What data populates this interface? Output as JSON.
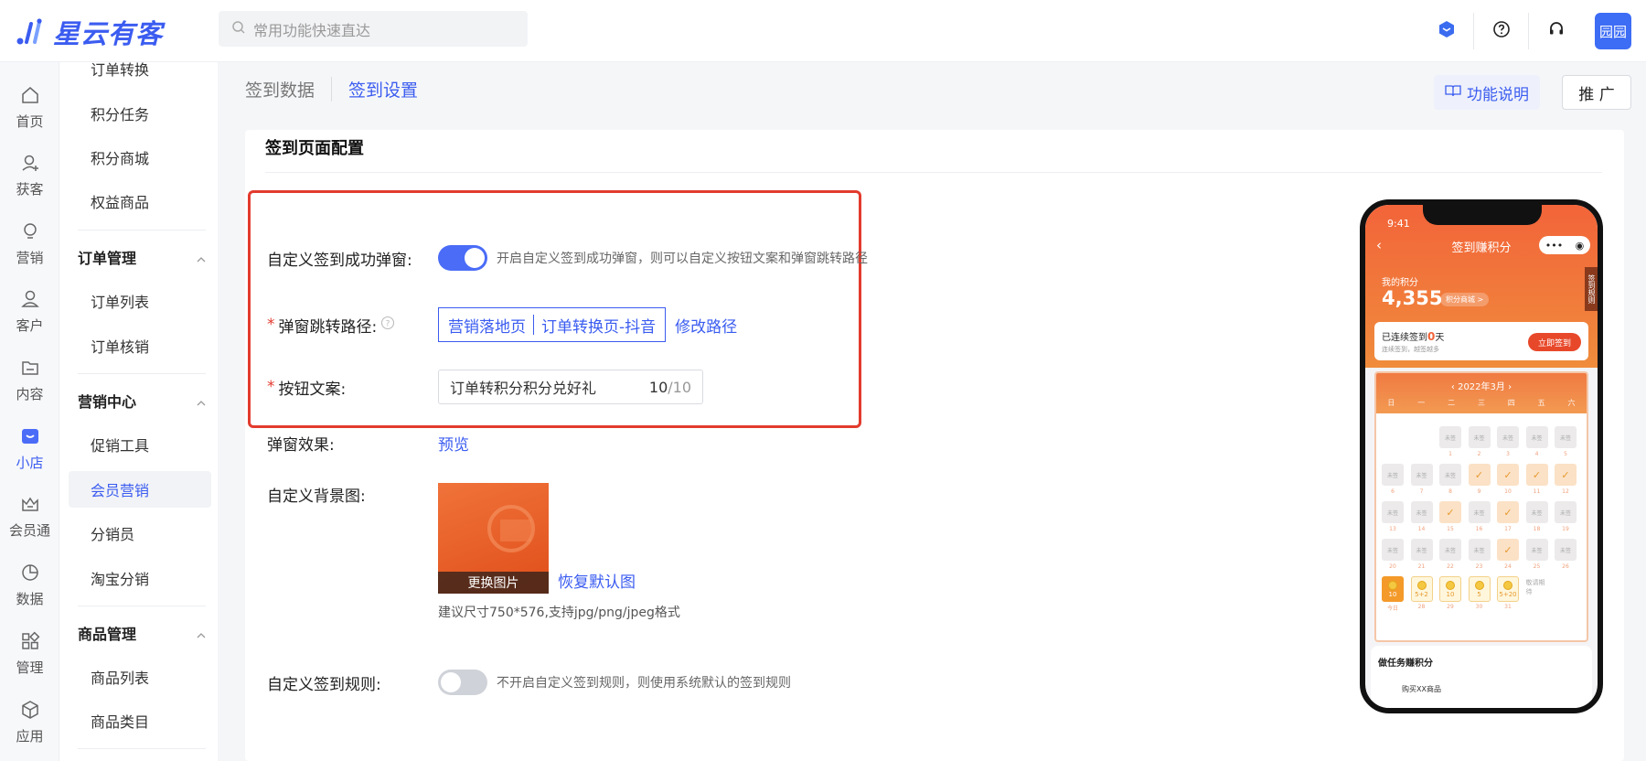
{
  "app": {
    "name": "星云有客"
  },
  "search": {
    "placeholder": "常用功能快速直达"
  },
  "topbar": {
    "avatar_text": "园园"
  },
  "rail": [
    {
      "label": "首页",
      "icon": "home-icon"
    },
    {
      "label": "获客",
      "icon": "user-add-icon"
    },
    {
      "label": "营销",
      "icon": "bulb-icon"
    },
    {
      "label": "客户",
      "icon": "person-icon"
    },
    {
      "label": "内容",
      "icon": "folder-icon"
    },
    {
      "label": "小店",
      "icon": "shop-icon"
    },
    {
      "label": "会员通",
      "icon": "crown-icon"
    },
    {
      "label": "数据",
      "icon": "pie-chart-icon"
    },
    {
      "label": "管理",
      "icon": "grid-icon"
    },
    {
      "label": "应用",
      "icon": "cube-icon"
    }
  ],
  "menu": {
    "items_top": [
      "订单转换",
      "积分任务",
      "积分商城",
      "权益商品"
    ],
    "group_order": "订单管理",
    "items_order": [
      "订单列表",
      "订单核销"
    ],
    "group_marketing": "营销中心",
    "items_marketing": [
      "促销工具",
      "会员营销",
      "分销员",
      "淘宝分销"
    ],
    "group_goods": "商品管理",
    "items_goods": [
      "商品列表",
      "商品类目"
    ]
  },
  "tabs": {
    "data": "签到数据",
    "settings": "签到设置"
  },
  "header_buttons": {
    "help": "功能说明",
    "promo": "推 广"
  },
  "section": {
    "title": "签到页面配置"
  },
  "form": {
    "popup_label": "自定义签到成功弹窗:",
    "popup_hint": "开启自定义签到成功弹窗，则可以自定义按钮文案和弹窗跳转路径",
    "path_label": "弹窗跳转路径:",
    "path_tag_a": "营销落地页",
    "path_tag_b": "订单转换页-抖音",
    "path_modify": "修改路径",
    "button_label": "按钮文案:",
    "button_value": "订单转积分积分兑好礼",
    "button_count": "10",
    "button_max": "/10",
    "effect_label": "弹窗效果:",
    "effect_link": "预览",
    "bg_label": "自定义背景图:",
    "bg_change": "更换图片",
    "bg_restore": "恢复默认图",
    "bg_hint": "建议尺寸750*576,支持jpg/png/jpeg格式",
    "rule_label": "自定义签到规则:",
    "rule_hint": "不开启自定义签到规则，则使用系统默认的签到规则"
  },
  "phone": {
    "time": "9:41",
    "title": "签到赚积分",
    "my_points_label": "我的积分",
    "points": "4,355",
    "mall": "积分商城 >",
    "rule": "签到规则",
    "streak_prefix": "已连续签到",
    "streak_days": "0",
    "streak_suffix": "天",
    "streak_sub": "连续签到，越签越多",
    "sign_button": "立即签到",
    "month": "‹  2022年3月  ›",
    "weekdays": [
      "日",
      "一",
      "二",
      "三",
      "四",
      "五",
      "六"
    ],
    "unsigned": "未签",
    "today": "今日",
    "wait": "敬请期待",
    "coin_rewards": [
      "10",
      "5+2",
      "10",
      "5",
      "5+20"
    ],
    "coin_days": [
      "今日",
      "28",
      "29",
      "30",
      "31"
    ],
    "task_title": "做任务赚积分",
    "task_item": "购买XX商品"
  }
}
